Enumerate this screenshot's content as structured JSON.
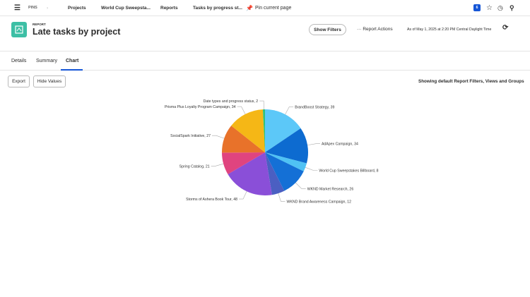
{
  "nav": {
    "pins": "PINS",
    "crumbs": [
      "Projects",
      "World Cup Sweepsta...",
      "Reports",
      "Tasks by progress st..."
    ],
    "pin": "Pin current page",
    "badge": "6"
  },
  "header": {
    "eyebrow": "REPORT",
    "title": "Late tasks by project",
    "show_filters": "Show Filters",
    "report_actions": "Report Actions",
    "timestamp": "As of May 1, 2025 at 2:20 PM Central Daylight Time"
  },
  "tabs": [
    "Details",
    "Summary",
    "Chart"
  ],
  "toolbar": {
    "export": "Export",
    "hide_values": "Hide Values",
    "info": "Showing default Report Filters, Views and Groups"
  },
  "chart_data": {
    "type": "pie",
    "slices": [
      {
        "label": "BrandBoost Strategy",
        "value": 39,
        "color": "#5cc8f8"
      },
      {
        "label": "AdApex Campaign",
        "value": 34,
        "color": "#0d6bd0"
      },
      {
        "label": "World Cup Sweepstakes Billboard",
        "value": 8,
        "color": "#4fc2f4"
      },
      {
        "label": "WKND Market Research",
        "value": 26,
        "color": "#1470d6"
      },
      {
        "label": "WKND Brand Awareness Campaign",
        "value": 12,
        "color": "#4b5fc2"
      },
      {
        "label": "Storms of Ashera Book Tour",
        "value": 48,
        "color": "#8a4fd8"
      },
      {
        "label": "Spring Catalog",
        "value": 21,
        "color": "#e0447f"
      },
      {
        "label": "SocialSpark Initiative",
        "value": 27,
        "color": "#e8722a"
      },
      {
        "label": "Prisma Plus Loyalty Program Campaign",
        "value": 34,
        "color": "#f5b716"
      },
      {
        "label": "Date types and progress status",
        "value": 2,
        "color": "#2fc27a"
      }
    ]
  }
}
